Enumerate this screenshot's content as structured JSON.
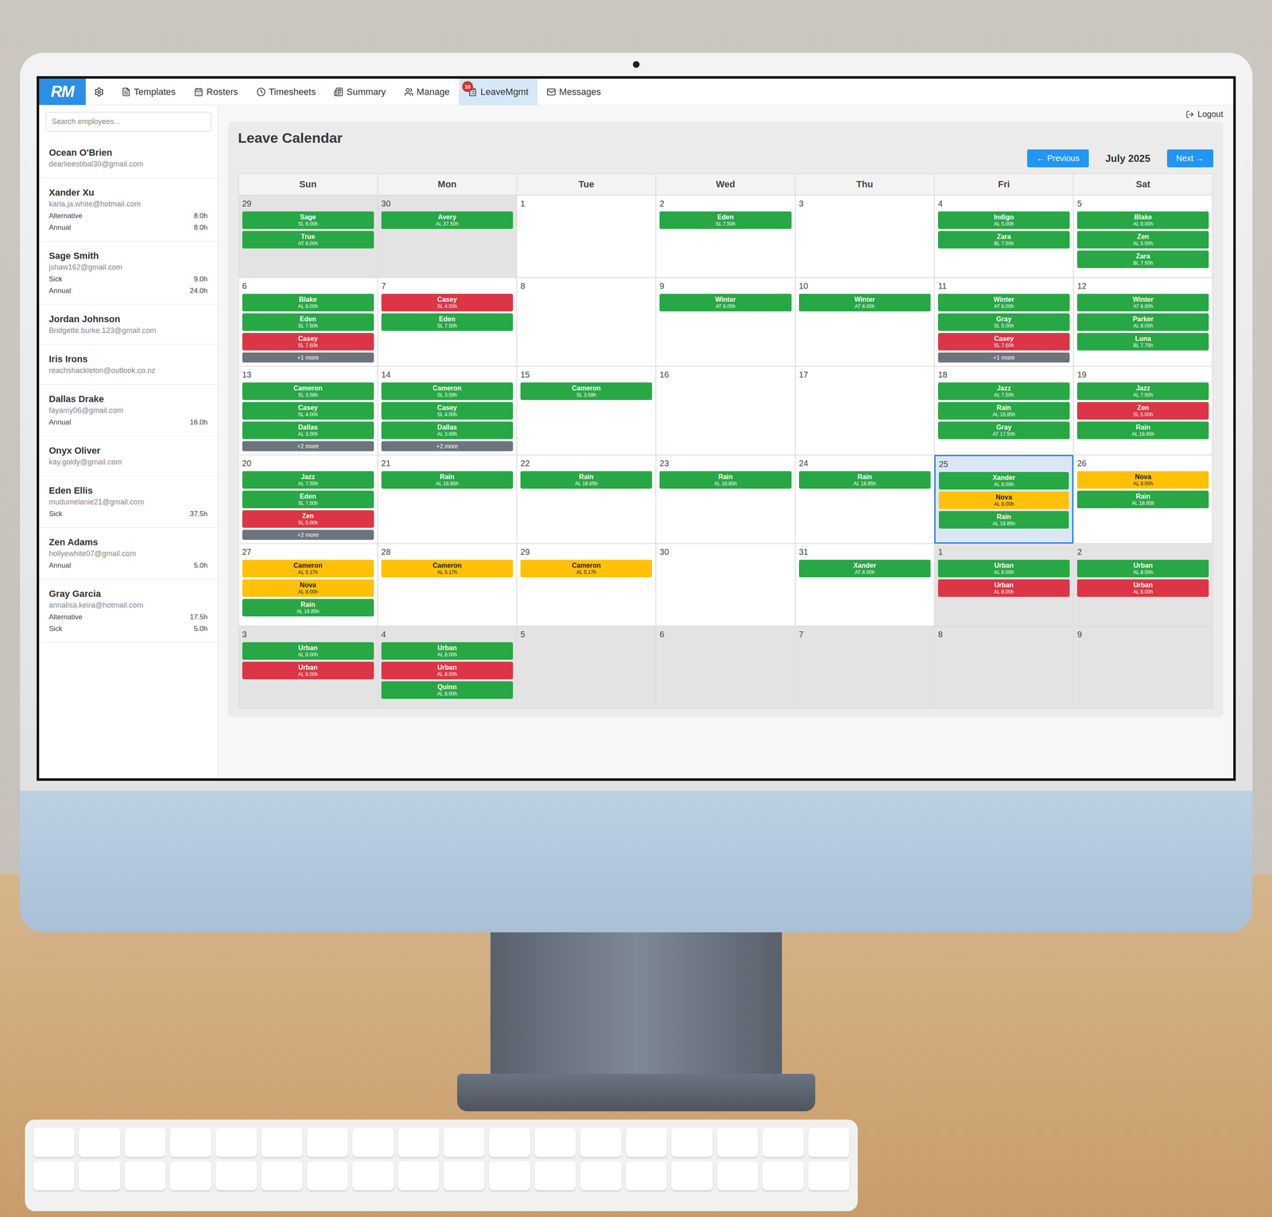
{
  "logo": "RM",
  "nav": [
    {
      "label": "Templates",
      "selected": false
    },
    {
      "label": "Rosters",
      "selected": false
    },
    {
      "label": "Timesheets",
      "selected": false
    },
    {
      "label": "Summary",
      "selected": false
    },
    {
      "label": "Manage",
      "selected": false
    },
    {
      "label": "LeaveMgmt",
      "selected": true,
      "badge": "10"
    },
    {
      "label": "Messages",
      "selected": false
    }
  ],
  "logout": "Logout",
  "search": {
    "placeholder": "Search employees..."
  },
  "employees": [
    {
      "name": "Ocean O'Brien",
      "email": "dearlieestibal30@gmail.com",
      "leave": []
    },
    {
      "name": "Xander Xu",
      "email": "karla.ja.white@hotmail.com",
      "leave": [
        {
          "type": "Alternative",
          "hours": "8.0h"
        },
        {
          "type": "Annual",
          "hours": "8.0h"
        }
      ]
    },
    {
      "name": "Sage Smith",
      "email": "jshaw162@gmail.com",
      "leave": [
        {
          "type": "Sick",
          "hours": "9.0h"
        },
        {
          "type": "Annual",
          "hours": "24.0h"
        }
      ]
    },
    {
      "name": "Jordan Johnson",
      "email": "Bridgette.burke.123@gmail.com",
      "leave": []
    },
    {
      "name": "Iris Irons",
      "email": "reachshackleton@outlook.co.nz",
      "leave": []
    },
    {
      "name": "Dallas Drake",
      "email": "fayamy06@gmail.com",
      "leave": [
        {
          "type": "Annual",
          "hours": "16.0h"
        }
      ]
    },
    {
      "name": "Onyx Oliver",
      "email": "kay.goldy@gmail.com",
      "leave": []
    },
    {
      "name": "Eden Ellis",
      "email": "mudumelanie21@gmail.com",
      "leave": [
        {
          "type": "Sick",
          "hours": "37.5h"
        }
      ]
    },
    {
      "name": "Zen Adams",
      "email": "hollyewhite07@gmail.com",
      "leave": [
        {
          "type": "Annual",
          "hours": "5.0h"
        }
      ]
    },
    {
      "name": "Gray Garcia",
      "email": "annalisa.keira@hotmail.com",
      "leave": [
        {
          "type": "Alternative",
          "hours": "17.5h"
        },
        {
          "type": "Sick",
          "hours": "5.0h"
        }
      ]
    }
  ],
  "calendar": {
    "title": "Leave Calendar",
    "previous": "← Previous",
    "month": "July 2025",
    "next": "Next →",
    "weekdays": [
      "Sun",
      "Mon",
      "Tue",
      "Wed",
      "Thu",
      "Fri",
      "Sat"
    ],
    "weeks": [
      [
        {
          "day": "29",
          "other_month": true,
          "today": false,
          "entries": [
            {
              "name": "Sage",
              "detail": "SL 9.00h",
              "color": "#28a745"
            },
            {
              "name": "True",
              "detail": "AT 8.00h",
              "color": "#28a745"
            }
          ]
        },
        {
          "day": "30",
          "other_month": true,
          "today": false,
          "entries": [
            {
              "name": "Avery",
              "detail": "AL 37.50h",
              "color": "#28a745"
            }
          ]
        },
        {
          "day": "1",
          "other_month": false,
          "today": false,
          "entries": []
        },
        {
          "day": "2",
          "other_month": false,
          "today": false,
          "entries": [
            {
              "name": "Eden",
              "detail": "SL 7.50h",
              "color": "#28a745"
            }
          ]
        },
        {
          "day": "3",
          "other_month": false,
          "today": false,
          "entries": []
        },
        {
          "day": "4",
          "other_month": false,
          "today": false,
          "entries": [
            {
              "name": "Indigo",
              "detail": "AL 5.00h",
              "color": "#28a745"
            },
            {
              "name": "Zara",
              "detail": "BL 7.50h",
              "color": "#28a745"
            }
          ]
        },
        {
          "day": "5",
          "other_month": false,
          "today": false,
          "entries": [
            {
              "name": "Blake",
              "detail": "AL 8.00h",
              "color": "#28a745"
            },
            {
              "name": "Zen",
              "detail": "AL 5.00h",
              "color": "#28a745"
            },
            {
              "name": "Zara",
              "detail": "BL 7.50h",
              "color": "#28a745"
            }
          ]
        }
      ],
      [
        {
          "day": "6",
          "other_month": false,
          "today": false,
          "entries": [
            {
              "name": "Blake",
              "detail": "AL 8.00h",
              "color": "#28a745"
            },
            {
              "name": "Eden",
              "detail": "SL 7.50h",
              "color": "#28a745"
            },
            {
              "name": "Casey",
              "detail": "SL 7.50h",
              "color": "#dc3545"
            }
          ],
          "more": "+1 more"
        },
        {
          "day": "7",
          "other_month": false,
          "today": false,
          "entries": [
            {
              "name": "Casey",
              "detail": "SL 4.00h",
              "color": "#dc3545"
            },
            {
              "name": "Eden",
              "detail": "SL 7.50h",
              "color": "#28a745"
            }
          ]
        },
        {
          "day": "8",
          "other_month": false,
          "today": false,
          "entries": []
        },
        {
          "day": "9",
          "other_month": false,
          "today": false,
          "entries": [
            {
              "name": "Winter",
              "detail": "AT 8.00h",
              "color": "#28a745"
            }
          ]
        },
        {
          "day": "10",
          "other_month": false,
          "today": false,
          "entries": [
            {
              "name": "Winter",
              "detail": "AT 8.00h",
              "color": "#28a745"
            }
          ]
        },
        {
          "day": "11",
          "other_month": false,
          "today": false,
          "entries": [
            {
              "name": "Winter",
              "detail": "AT 8.00h",
              "color": "#28a745"
            },
            {
              "name": "Gray",
              "detail": "SL 5.00h",
              "color": "#28a745"
            },
            {
              "name": "Casey",
              "detail": "SL 7.50h",
              "color": "#dc3545"
            }
          ],
          "more": "+1 more"
        },
        {
          "day": "12",
          "other_month": false,
          "today": false,
          "entries": [
            {
              "name": "Winter",
              "detail": "AT 8.00h",
              "color": "#28a745"
            },
            {
              "name": "Parker",
              "detail": "AL 8.00h",
              "color": "#28a745"
            },
            {
              "name": "Luna",
              "detail": "BL 7.75h",
              "color": "#28a745"
            }
          ]
        }
      ],
      [
        {
          "day": "13",
          "other_month": false,
          "today": false,
          "entries": [
            {
              "name": "Cameron",
              "detail": "SL 3.58h",
              "color": "#28a745"
            },
            {
              "name": "Casey",
              "detail": "SL 4.00h",
              "color": "#28a745"
            },
            {
              "name": "Dallas",
              "detail": "AL 3.00h",
              "color": "#28a745"
            }
          ],
          "more": "+2 more"
        },
        {
          "day": "14",
          "other_month": false,
          "today": false,
          "entries": [
            {
              "name": "Cameron",
              "detail": "SL 3.58h",
              "color": "#28a745"
            },
            {
              "name": "Casey",
              "detail": "SL 4.00h",
              "color": "#28a745"
            },
            {
              "name": "Dallas",
              "detail": "AL 3.00h",
              "color": "#28a745"
            }
          ],
          "more": "+2 more"
        },
        {
          "day": "15",
          "other_month": false,
          "today": false,
          "entries": [
            {
              "name": "Cameron",
              "detail": "SL 3.58h",
              "color": "#28a745"
            }
          ]
        },
        {
          "day": "16",
          "other_month": false,
          "today": false,
          "entries": []
        },
        {
          "day": "17",
          "other_month": false,
          "today": false,
          "entries": []
        },
        {
          "day": "18",
          "other_month": false,
          "today": false,
          "entries": [
            {
              "name": "Jazz",
              "detail": "AL 7.50h",
              "color": "#28a745"
            },
            {
              "name": "Rain",
              "detail": "AL 18.85h",
              "color": "#28a745"
            },
            {
              "name": "Gray",
              "detail": "AT 17.50h",
              "color": "#28a745"
            }
          ]
        },
        {
          "day": "19",
          "other_month": false,
          "today": false,
          "entries": [
            {
              "name": "Jazz",
              "detail": "AL 7.50h",
              "color": "#28a745"
            },
            {
              "name": "Zen",
              "detail": "SL 5.00h",
              "color": "#dc3545"
            },
            {
              "name": "Rain",
              "detail": "AL 18.85h",
              "color": "#28a745"
            }
          ]
        }
      ],
      [
        {
          "day": "20",
          "other_month": false,
          "today": false,
          "entries": [
            {
              "name": "Jazz",
              "detail": "AL 7.50h",
              "color": "#28a745"
            },
            {
              "name": "Eden",
              "detail": "SL 7.50h",
              "color": "#28a745"
            },
            {
              "name": "Zen",
              "detail": "SL 5.00h",
              "color": "#dc3545"
            }
          ],
          "more": "+2 more"
        },
        {
          "day": "21",
          "other_month": false,
          "today": false,
          "entries": [
            {
              "name": "Rain",
              "detail": "AL 18.85h",
              "color": "#28a745"
            }
          ]
        },
        {
          "day": "22",
          "other_month": false,
          "today": false,
          "entries": [
            {
              "name": "Rain",
              "detail": "AL 18.85h",
              "color": "#28a745"
            }
          ]
        },
        {
          "day": "23",
          "other_month": false,
          "today": false,
          "entries": [
            {
              "name": "Rain",
              "detail": "AL 18.85h",
              "color": "#28a745"
            }
          ]
        },
        {
          "day": "24",
          "other_month": false,
          "today": false,
          "entries": [
            {
              "name": "Rain",
              "detail": "AL 18.85h",
              "color": "#28a745"
            }
          ]
        },
        {
          "day": "25",
          "other_month": false,
          "today": true,
          "entries": [
            {
              "name": "Xander",
              "detail": "AL 8.00h",
              "color": "#28a745"
            },
            {
              "name": "Nova",
              "detail": "AL 8.00h",
              "color": "#ffc107"
            },
            {
              "name": "Rain",
              "detail": "AL 18.85h",
              "color": "#28a745"
            }
          ]
        },
        {
          "day": "26",
          "other_month": false,
          "today": false,
          "entries": [
            {
              "name": "Nova",
              "detail": "AL 8.00h",
              "color": "#ffc107"
            },
            {
              "name": "Rain",
              "detail": "AL 18.85h",
              "color": "#28a745"
            }
          ]
        }
      ],
      [
        {
          "day": "27",
          "other_month": false,
          "today": false,
          "entries": [
            {
              "name": "Cameron",
              "detail": "AL 5.17h",
              "color": "#ffc107"
            },
            {
              "name": "Nova",
              "detail": "AL 8.00h",
              "color": "#ffc107"
            },
            {
              "name": "Rain",
              "detail": "AL 18.85h",
              "color": "#28a745"
            }
          ]
        },
        {
          "day": "28",
          "other_month": false,
          "today": false,
          "entries": [
            {
              "name": "Cameron",
              "detail": "AL 5.17h",
              "color": "#ffc107"
            }
          ]
        },
        {
          "day": "29",
          "other_month": false,
          "today": false,
          "entries": [
            {
              "name": "Cameron",
              "detail": "AL 5.17h",
              "color": "#ffc107"
            }
          ]
        },
        {
          "day": "30",
          "other_month": false,
          "today": false,
          "entries": []
        },
        {
          "day": "31",
          "other_month": false,
          "today": false,
          "entries": [
            {
              "name": "Xander",
              "detail": "AT 8.00h",
              "color": "#28a745"
            }
          ]
        },
        {
          "day": "1",
          "other_month": true,
          "today": false,
          "entries": [
            {
              "name": "Urban",
              "detail": "AL 8.00h",
              "color": "#28a745"
            },
            {
              "name": "Urban",
              "detail": "AL 8.00h",
              "color": "#dc3545"
            }
          ]
        },
        {
          "day": "2",
          "other_month": true,
          "today": false,
          "entries": [
            {
              "name": "Urban",
              "detail": "AL 8.00h",
              "color": "#28a745"
            },
            {
              "name": "Urban",
              "detail": "AL 8.00h",
              "color": "#dc3545"
            }
          ]
        }
      ],
      [
        {
          "day": "3",
          "other_month": true,
          "today": false,
          "entries": [
            {
              "name": "Urban",
              "detail": "AL 8.00h",
              "color": "#28a745"
            },
            {
              "name": "Urban",
              "detail": "AL 8.00h",
              "color": "#dc3545"
            }
          ]
        },
        {
          "day": "4",
          "other_month": true,
          "today": false,
          "entries": [
            {
              "name": "Urban",
              "detail": "AL 8.00h",
              "color": "#28a745"
            },
            {
              "name": "Urban",
              "detail": "AL 8.00h",
              "color": "#dc3545"
            },
            {
              "name": "Quinn",
              "detail": "AL 8.00h",
              "color": "#28a745"
            }
          ]
        },
        {
          "day": "5",
          "other_month": true,
          "today": false,
          "entries": []
        },
        {
          "day": "6",
          "other_month": true,
          "today": false,
          "entries": []
        },
        {
          "day": "7",
          "other_month": true,
          "today": false,
          "entries": []
        },
        {
          "day": "8",
          "other_month": true,
          "today": false,
          "entries": []
        },
        {
          "day": "9",
          "other_month": true,
          "today": false,
          "entries": []
        }
      ]
    ]
  }
}
